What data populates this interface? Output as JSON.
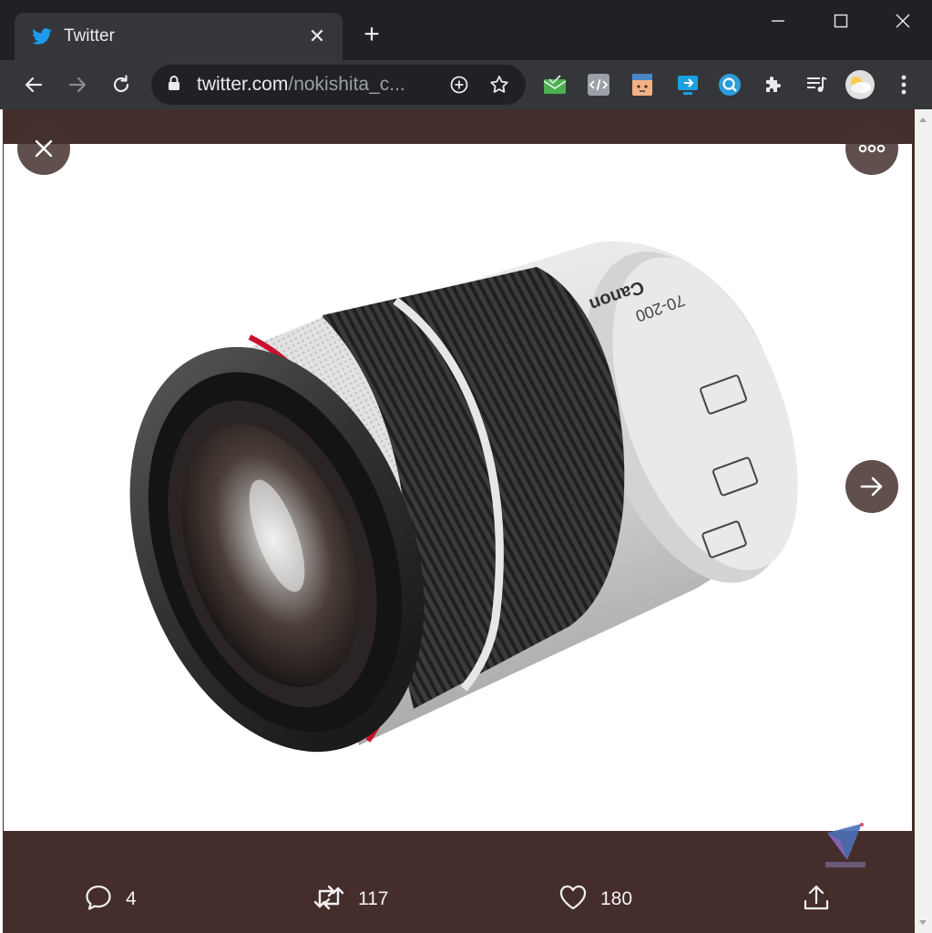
{
  "browser": {
    "tab": {
      "title": "Twitter"
    },
    "address": {
      "host": "twitter.com",
      "path": "/nokishita_c..."
    },
    "extensions": [
      "mail-check-icon",
      "code-view-icon",
      "face-extension-icon",
      "screen-share-icon",
      "search-extension-icon",
      "puzzle-icon",
      "media-control-icon",
      "profile-avatar"
    ],
    "colors": {
      "titlebar": "#202124",
      "toolbar": "#35363a",
      "twitter_blue": "#1d9bf0",
      "page_bg": "#452d2c"
    }
  },
  "media_viewer": {
    "image_subject": "camera lens",
    "lens_text": {
      "brand": "Canon",
      "focal": "70-200"
    },
    "actions": {
      "replies": "4",
      "retweets": "117",
      "likes": "180"
    }
  }
}
